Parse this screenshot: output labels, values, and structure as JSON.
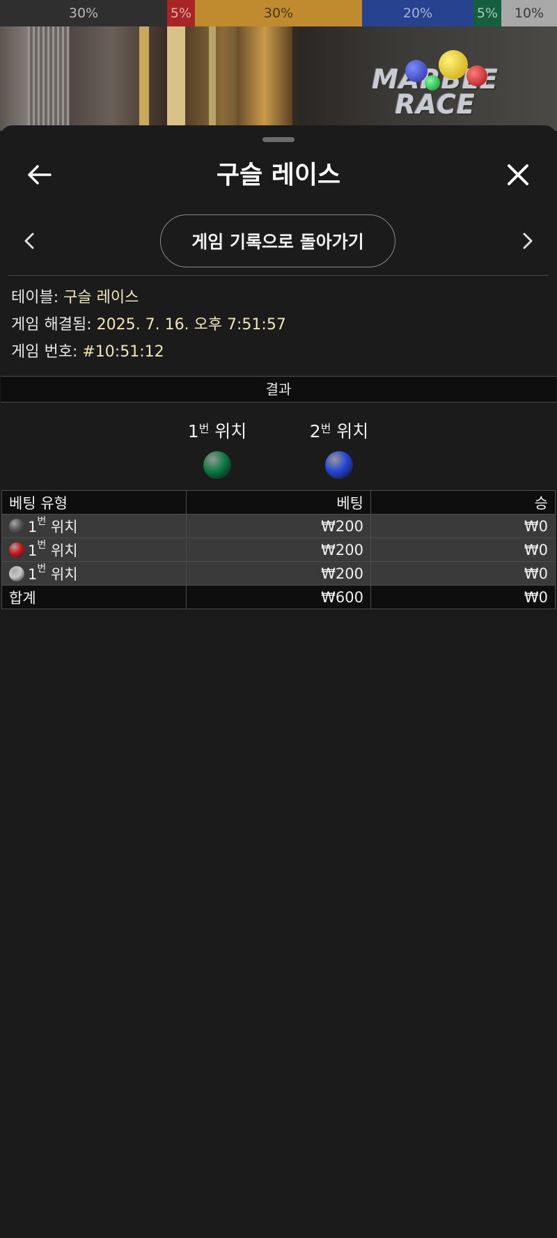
{
  "odds_bar": [
    {
      "label": "30%",
      "color": "#2f2f2f",
      "text_color": "#b9b9b9",
      "weight": 240
    },
    {
      "label": "5%",
      "color": "#a82525",
      "text_color": "#e0b0b0",
      "weight": 40
    },
    {
      "label": "30%",
      "color": "#c08a2e",
      "text_color": "#4a3614",
      "weight": 240
    },
    {
      "label": "20%",
      "color": "#27428f",
      "text_color": "#a6b2d6",
      "weight": 160
    },
    {
      "label": "5%",
      "color": "#155e3e",
      "text_color": "#a8ccb8",
      "weight": 40
    },
    {
      "label": "10%",
      "color": "#a8a8a8",
      "text_color": "#3a3a3a",
      "weight": 80
    }
  ],
  "video": {
    "logo_line1": "MARBLE",
    "logo_line2": "RACE"
  },
  "header": {
    "title": "구슬 레이스",
    "back_icon": "arrow-left-icon",
    "close_icon": "close-icon"
  },
  "nav": {
    "prev_icon": "chevron-left-icon",
    "next_icon": "chevron-right-icon",
    "history_label": "게임 기록으로 돌아가기"
  },
  "info": {
    "table_label": "테이블: ",
    "table_value": "구슬 레이스",
    "resolved_label": "게임 해결됨: ",
    "resolved_value": "2025. 7. 16. 오후 7:51:57",
    "game_no_label": "게임 번호: ",
    "game_no_value": "#10:51:12"
  },
  "result": {
    "header": "결과",
    "positions": [
      {
        "num": "1",
        "suffix": "번",
        "word": " 위치",
        "marble_color": "#0d7a44"
      },
      {
        "num": "2",
        "suffix": "번",
        "word": " 위치",
        "marble_color": "#2447d8"
      }
    ]
  },
  "bets_table": {
    "headers": [
      "베팅 유형",
      "베팅",
      "승"
    ],
    "rows": [
      {
        "chip_color": "#555555",
        "num": "1",
        "suffix": "번",
        "word": " 위치",
        "bet": "₩200",
        "win": "₩0"
      },
      {
        "chip_color": "#d01818",
        "num": "1",
        "suffix": "번",
        "word": " 위치",
        "bet": "₩200",
        "win": "₩0"
      },
      {
        "chip_color": "#c8c8c8",
        "num": "1",
        "suffix": "번",
        "word": " 위치",
        "bet": "₩200",
        "win": "₩0"
      }
    ],
    "total": {
      "label": "합계",
      "bet": "₩600",
      "win": "₩0"
    }
  }
}
